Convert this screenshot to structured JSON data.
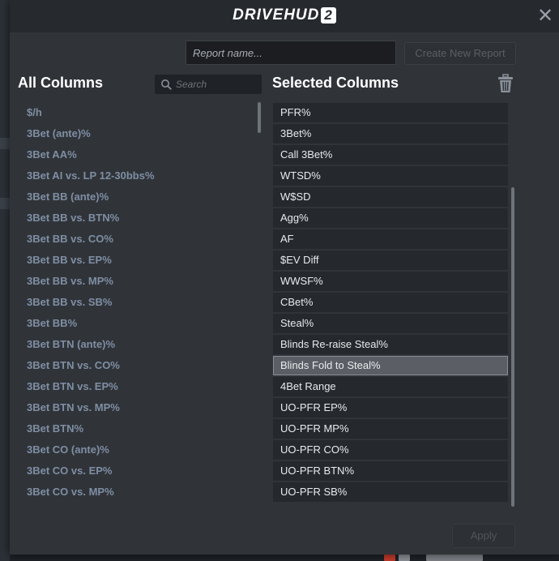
{
  "header": {
    "logo_text": "DRIVEHUD",
    "logo_badge": "2",
    "close_label": "✕"
  },
  "report": {
    "name_placeholder": "Report name...",
    "name_value": "",
    "create_label": "Create New Report"
  },
  "all_columns": {
    "title": "All Columns",
    "search_placeholder": "Search",
    "search_value": "",
    "items": [
      "$/h",
      "3Bet (ante)%",
      "3Bet AA%",
      "3Bet AI vs. LP 12-30bbs%",
      "3Bet BB (ante)%",
      "3Bet BB vs. BTN%",
      "3Bet BB vs. CO%",
      "3Bet BB vs. EP%",
      "3Bet BB vs. MP%",
      "3Bet BB vs. SB%",
      "3Bet BB%",
      "3Bet BTN (ante)%",
      "3Bet BTN vs. CO%",
      "3Bet BTN vs. EP%",
      "3Bet BTN vs. MP%",
      "3Bet BTN%",
      "3Bet CO (ante)%",
      "3Bet CO vs. EP%",
      "3Bet CO vs. MP%"
    ]
  },
  "selected_columns": {
    "title": "Selected Columns",
    "active_index": 12,
    "items": [
      "PFR%",
      "3Bet%",
      "Call 3Bet%",
      "WTSD%",
      "W$SD",
      "Agg%",
      "AF",
      "$EV Diff",
      "WWSF%",
      "CBet%",
      "Steal%",
      "Blinds Re-raise Steal%",
      "Blinds Fold to Steal%",
      "4Bet Range",
      "UO-PFR EP%",
      "UO-PFR MP%",
      "UO-PFR CO%",
      "UO-PFR BTN%",
      "UO-PFR SB%"
    ]
  },
  "footer": {
    "apply_label": "Apply"
  },
  "colors": {
    "modal_bg": "#303439",
    "header_bg": "#26292e",
    "all_item_text": "#7f8ea3",
    "selected_item_bg": "#25282c",
    "active_item_bg": "#5b5f65"
  },
  "icons": {
    "search": "search-icon",
    "trash": "trash-icon",
    "close": "close-icon"
  }
}
